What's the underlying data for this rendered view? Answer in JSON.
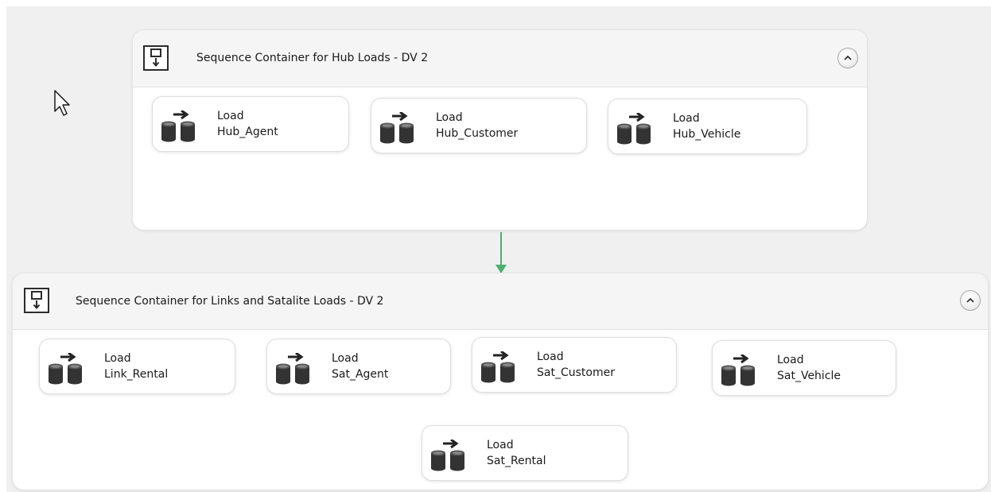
{
  "hub_container": {
    "title": "Sequence Container for Hub Loads - DV 2",
    "icon": "sequence-container-icon",
    "collapse_icon": "chevron-up-icon",
    "tasks": [
      {
        "line1": "Load",
        "line2": "Hub_Agent"
      },
      {
        "line1": "Load",
        "line2": "Hub_Customer"
      },
      {
        "line1": "Load",
        "line2": "Hub_Vehicle"
      }
    ]
  },
  "links_container": {
    "title": "Sequence Container for Links and Satalite Loads  - DV 2",
    "icon": "sequence-container-icon",
    "collapse_icon": "chevron-up-icon",
    "tasks": [
      {
        "line1": "Load",
        "line2": "Link_Rental"
      },
      {
        "line1": "Load",
        "line2": "Sat_Agent"
      },
      {
        "line1": "Load",
        "line2": "Sat_Customer"
      },
      {
        "line1": "Load",
        "line2": "Sat_Vehicle"
      },
      {
        "line1": "Load",
        "line2": "Sat_Rental"
      }
    ]
  },
  "task_icon": "data-flow-task-icon",
  "precedence_color": "#4caf70"
}
